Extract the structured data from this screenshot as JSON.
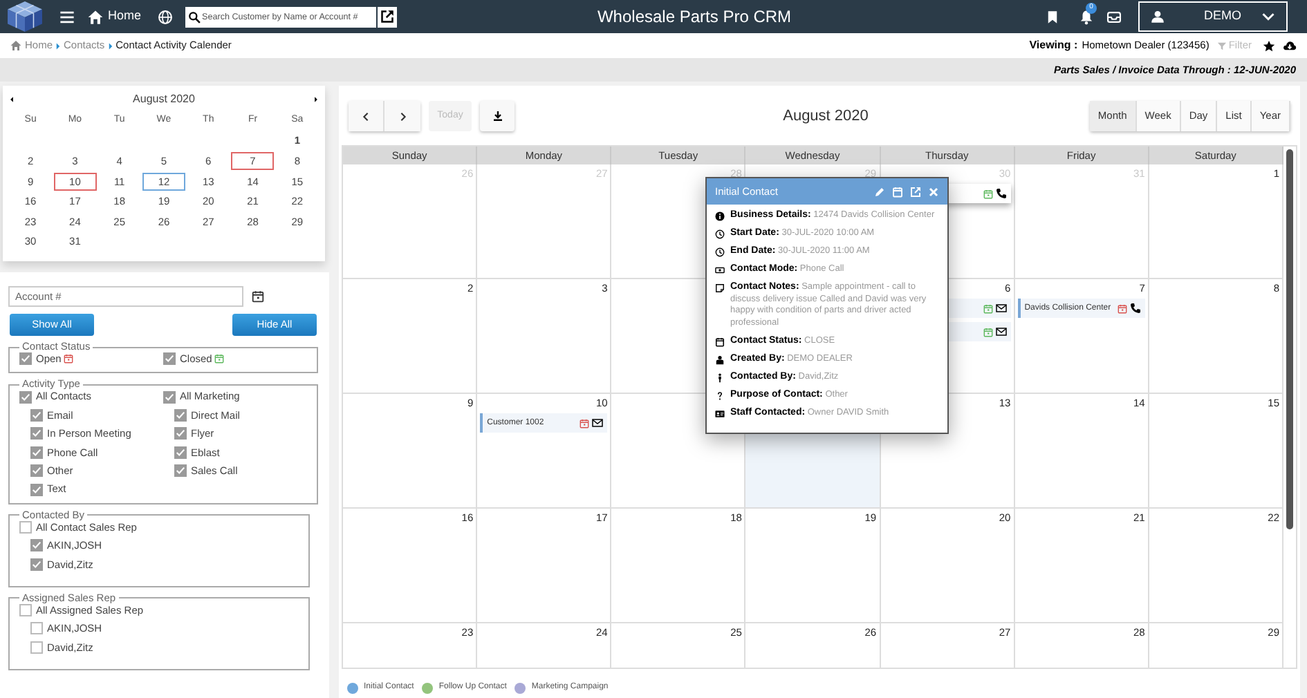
{
  "top_bar": {
    "home": "Home",
    "search_placeholder": "Search Customer by Name or Account #",
    "title": "Wholesale Parts Pro CRM",
    "notification_count": "0",
    "user": "DEMO"
  },
  "breadcrumb": [
    {
      "label": "Home"
    },
    {
      "label": "Contacts"
    },
    {
      "label": "Contact Activity Calender"
    }
  ],
  "viewing": {
    "label": "Viewing :",
    "dealer": "Hometown Dealer (123456)",
    "filter": "Filter",
    "filter_disabled": true
  },
  "data_notice": "Parts Sales / Invoice Data Through : 12-JUN-2020",
  "mini_calendar": {
    "title": "August 2020",
    "weekdays": [
      "Su",
      "Mo",
      "Tu",
      "We",
      "Th",
      "Fr",
      "Sa"
    ],
    "weeks": [
      [
        {
          "day": "1"
        }
      ],
      [
        {
          "day": "2"
        },
        {
          "day": "3"
        },
        {
          "day": "4"
        },
        {
          "day": "5"
        },
        {
          "day": "6"
        },
        {
          "day": "7",
          "color": "#e06666"
        },
        {
          "day": "8"
        }
      ],
      [
        {
          "day": "9"
        },
        {
          "day": "10",
          "color": "#e06666"
        },
        {
          "day": "11"
        },
        {
          "day": "12",
          "color": "#6fa8dc"
        },
        {
          "day": "13"
        },
        {
          "day": "14"
        },
        {
          "day": "15"
        }
      ],
      [
        {
          "day": "16"
        },
        {
          "day": "17"
        },
        {
          "day": "18"
        },
        {
          "day": "19"
        },
        {
          "day": "20"
        },
        {
          "day": "21"
        },
        {
          "day": "22"
        }
      ],
      [
        {
          "day": "23"
        },
        {
          "day": "24"
        },
        {
          "day": "25"
        },
        {
          "day": "26"
        },
        {
          "day": "27"
        },
        {
          "day": "28"
        },
        {
          "day": "29"
        }
      ],
      [
        {
          "day": "30"
        },
        {
          "day": "31"
        }
      ]
    ]
  },
  "account_field": {
    "placeholder": "Account #"
  },
  "buttons": [
    "Show All",
    "Hide All"
  ],
  "filter_groups": [
    {
      "legend": "Contact Status",
      "columns": [
        [
          {
            "label": "Open",
            "checked": true,
            "color": "#d9534f"
          }
        ],
        [
          {
            "label": "Closed",
            "checked": true,
            "color": "#5cb85c"
          }
        ]
      ]
    },
    {
      "legend": "Activity Type",
      "columns": [
        [
          {
            "label": "All Contacts",
            "checked": true,
            "children": [
              {
                "label": "Email",
                "checked": true
              },
              {
                "label": "In Person Meeting",
                "checked": true
              },
              {
                "label": "Phone Call",
                "checked": true
              },
              {
                "label": "Other",
                "checked": true
              },
              {
                "label": "Text",
                "checked": true
              }
            ]
          }
        ],
        [
          {
            "label": "All Marketing",
            "checked": true,
            "children": [
              {
                "label": "Direct Mail",
                "checked": true
              },
              {
                "label": "Flyer",
                "checked": true
              },
              {
                "label": "Eblast",
                "checked": true
              },
              {
                "label": "Sales Call",
                "checked": true
              }
            ]
          }
        ]
      ]
    },
    {
      "legend": "Contacted By",
      "columns": [
        [
          {
            "label": "All Contact Sales Rep",
            "checked": false,
            "children": [
              {
                "label": "AKIN,JOSH",
                "checked": true
              },
              {
                "label": "David,Zitz",
                "checked": true
              }
            ]
          }
        ]
      ]
    },
    {
      "legend": "Assigned Sales Rep",
      "columns": [
        [
          {
            "label": "All Assigned Sales Rep",
            "checked": false,
            "children": [
              {
                "label": "AKIN,JOSH",
                "checked": false
              },
              {
                "label": "David,Zitz",
                "checked": false
              }
            ]
          }
        ]
      ]
    }
  ],
  "calendar": {
    "today_button": "Today",
    "today_disabled": true,
    "title": "August 2020",
    "views": [
      {
        "label": "Month",
        "selected": true
      },
      {
        "label": "Week",
        "selected": false
      },
      {
        "label": "Day",
        "selected": false
      },
      {
        "label": "List",
        "selected": false
      },
      {
        "label": "Year",
        "selected": false
      }
    ],
    "weekdays": [
      "Sunday",
      "Monday",
      "Tuesday",
      "Wednesday",
      "Thursday",
      "Friday",
      "Saturday"
    ],
    "weeks": [
      {
        "days": {
          "sun": {
            "day": "26",
            "other_month": true,
            "today": false
          },
          "mon": {
            "day": "27",
            "other_month": true,
            "today": false
          },
          "tue": {
            "day": "28",
            "other_month": true,
            "today": false
          },
          "wed": {
            "day": "29",
            "other_month": true,
            "today": false
          },
          "thu": {
            "day": "30",
            "other_month": true,
            "today": false,
            "events": [
              {
                "color": "#5cb85c",
                "kind": "phone",
                "raised": true
              }
            ]
          },
          "fri": {
            "day": "31",
            "other_month": true,
            "today": false
          },
          "sat": {
            "day": "1",
            "other_month": false,
            "today": false
          }
        }
      },
      {
        "days": {
          "sun": {
            "day": "2",
            "other_month": false,
            "today": false
          },
          "mon": {
            "day": "3",
            "other_month": false,
            "today": false
          },
          "thu": {
            "day": "6",
            "other_month": false,
            "today": false,
            "events": [
              {
                "color": "#5cb85c",
                "kind": "mail",
                "raised": false
              },
              {
                "color": "#5cb85c",
                "kind": "mail",
                "raised": false
              }
            ]
          },
          "fri": {
            "day": "7",
            "other_month": false,
            "today": false,
            "events": [
              {
                "label": "Davids Collision Center",
                "color": "#d9534f",
                "kind": "phone",
                "raised": false
              }
            ]
          },
          "sat": {
            "day": "8",
            "other_month": false,
            "today": false
          }
        }
      },
      {
        "days": {
          "sun": {
            "day": "9",
            "other_month": false,
            "today": false
          },
          "mon": {
            "day": "10",
            "other_month": false,
            "today": false,
            "events": [
              {
                "label": "Customer 1002",
                "color": "#d9534f",
                "kind": "mail",
                "raised": false
              }
            ]
          },
          "wed": {
            "today": true
          },
          "thu": {
            "day": "13",
            "other_month": false,
            "today": false
          },
          "fri": {
            "day": "14",
            "other_month": false,
            "today": false
          },
          "sat": {
            "day": "15",
            "other_month": false,
            "today": false
          }
        }
      },
      {
        "days": {
          "sun": {
            "day": "16",
            "other_month": false,
            "today": false
          },
          "mon": {
            "day": "17",
            "other_month": false,
            "today": false
          },
          "tue": {
            "day": "18",
            "other_month": false,
            "today": false
          },
          "wed": {
            "day": "19",
            "other_month": false,
            "today": false
          },
          "thu": {
            "day": "20",
            "other_month": false,
            "today": false
          },
          "fri": {
            "day": "21",
            "other_month": false,
            "today": false
          },
          "sat": {
            "day": "22",
            "other_month": false,
            "today": false
          }
        }
      },
      {
        "days": {
          "sun": {
            "day": "23",
            "other_month": false,
            "today": false
          },
          "mon": {
            "day": "24",
            "other_month": false,
            "today": false
          },
          "tue": {
            "day": "25",
            "other_month": false,
            "today": false
          },
          "wed": {
            "day": "26",
            "other_month": false,
            "today": false
          },
          "thu": {
            "day": "27",
            "other_month": false,
            "today": false
          },
          "fri": {
            "day": "28",
            "other_month": false,
            "today": false
          },
          "sat": {
            "day": "29",
            "other_month": false,
            "today": false
          }
        }
      }
    ]
  },
  "popup": {
    "title": "Initial Contact",
    "rows": [
      {
        "label": "Business Details:",
        "value": "12474 Davids Collision Center"
      },
      {
        "label": "Start Date:",
        "value": "30-JUL-2020 10:00 AM"
      },
      {
        "label": "End Date:",
        "value": "30-JUL-2020 11:00 AM"
      },
      {
        "label": "Contact Mode:",
        "value": "Phone Call"
      },
      {
        "label": "Contact Notes:",
        "value": "Sample appointment - call to discuss delivery issue Called and David was very happy with condition of parts and driver acted professional"
      },
      {
        "label": "Contact Status:",
        "value": "CLOSE"
      },
      {
        "label": "Created By:",
        "value": "DEMO DEALER"
      },
      {
        "label": "Contacted By:",
        "value": "David,Zitz"
      },
      {
        "label": "Purpose of Contact:",
        "value": "Other"
      },
      {
        "label": "Staff Contacted:",
        "value": "Owner DAVID Smith"
      }
    ]
  },
  "legend": [
    {
      "label": "Initial Contact",
      "color": "#6fa8dc"
    },
    {
      "label": "Follow Up Contact",
      "color": "#93c47d"
    },
    {
      "label": "Marketing Campaign",
      "color": "#a9a9d6"
    }
  ]
}
